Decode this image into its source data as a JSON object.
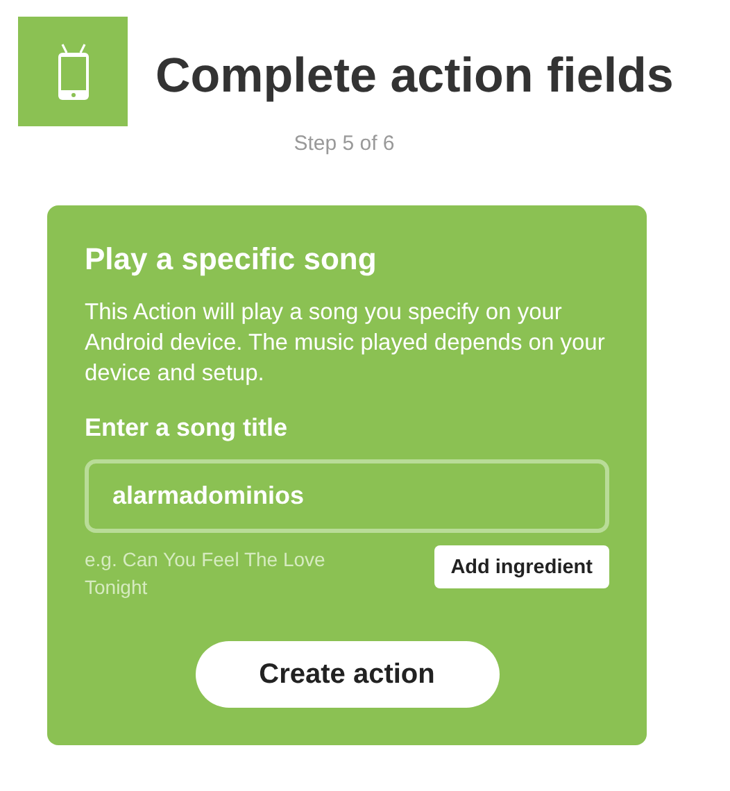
{
  "header": {
    "title": "Complete action fields",
    "step": "Step 5 of 6"
  },
  "card": {
    "heading": "Play a specific song",
    "description": "This Action will play a song you specify on your Android device. The music played depends on your device and setup.",
    "field": {
      "label": "Enter a song title",
      "value": "alarmadominios",
      "hint": "e.g. Can You Feel The Love Tonight",
      "button": "Add ingredient"
    },
    "submit": "Create action"
  }
}
